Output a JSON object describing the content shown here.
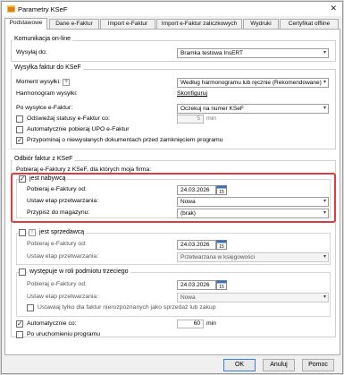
{
  "window": {
    "title": "Parametry KSeF"
  },
  "tabs": [
    {
      "label": "Podstawowe"
    },
    {
      "label": "Dane e-Faktur"
    },
    {
      "label": "Import e-Faktur"
    },
    {
      "label": "Import e-Faktur zaliczkowych"
    },
    {
      "label": "Wydruki"
    },
    {
      "label": "Certyfikat offline"
    }
  ],
  "online": {
    "group": "Komunikacja on-line",
    "send_label": "Wysyłaj do:",
    "send_value": "Bramka testowa InsERT"
  },
  "sending": {
    "group": "Wysyłka faktur do KSeF",
    "mode_label": "Moment wysyłki:",
    "mode_help": "?",
    "mode_value": "Według harmonogramu lub ręcznie (Rekomendowane)",
    "schedule_label": "Harmonogram wysyłki:",
    "schedule_link": "Skonfiguruj",
    "after_label": "Po wysyłce e-Faktur:",
    "after_value": "Oczekuj na numer KSeF",
    "refresh_label": "Odświeżaj statusy e-Faktur co:",
    "refresh_value": "5",
    "refresh_unit": "min",
    "upo_label": "Automatycznie pobieraj UPO e-Faktur",
    "remind_label": "Przypominaj o niewysłanych dokumentach przed zamknięciem programu"
  },
  "receiving": {
    "group": "Odbiór faktur z KSeF",
    "intro": "Pobieraj e-Faktury z KSeF, dla których moja firma:",
    "buyer": {
      "label": "jest nabywcą",
      "date_label": "Pobieraj e-Faktury od:",
      "date_value": "24.03.2026",
      "stage_label": "Ustaw etap przetwarzania:",
      "stage_value": "Nowa",
      "warehouse_label": "Przypisz do magazynu:",
      "warehouse_value": "(brak)"
    },
    "seller": {
      "help": "!",
      "label": "jest sprzedawcą",
      "date_label": "Pobieraj e-Faktury od:",
      "date_value": "24.03.2026",
      "stage_label": "Ustaw etap przetwarzania:",
      "stage_value": "Przetwarzana w księgowości"
    },
    "third": {
      "label": "występuje w roli podmiotu trzeciego",
      "date_label": "Pobieraj e-Faktury od:",
      "date_value": "24.03.2026",
      "stage_label": "Ustaw etap przetwarzania:",
      "stage_value": "Nowa",
      "only_label": "Ustawiaj tylko dla faktur nierozpoznanych jako sprzedaż lub zakup"
    },
    "auto_label": "Automatycznie co:",
    "auto_value": "60",
    "auto_unit": "min",
    "on_start_label": "Po uruchomieniu programu"
  },
  "buttons": {
    "ok": "OK",
    "cancel": "Anuluj",
    "help": "Pomoc"
  },
  "colors": {
    "highlight": "#e23b3b",
    "accent": "#3c7fd8"
  },
  "icons": [
    "app-icon",
    "close-icon",
    "chevron-down-icon",
    "calendar-icon",
    "help-icon",
    "checkmark-icon"
  ]
}
